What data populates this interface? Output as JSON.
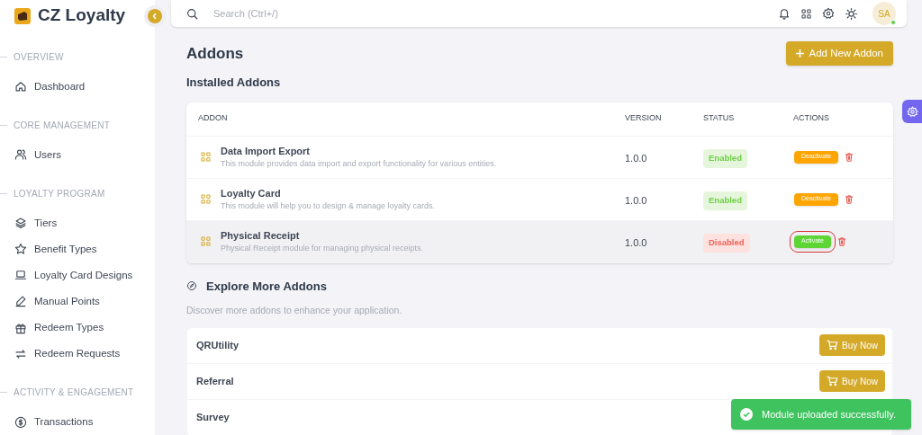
{
  "brand": "CZ Loyalty",
  "sidebar": {
    "sections": [
      {
        "title": "OVERVIEW",
        "items": [
          {
            "label": "Dashboard"
          }
        ]
      },
      {
        "title": "CORE MANAGEMENT",
        "items": [
          {
            "label": "Users"
          }
        ]
      },
      {
        "title": "LOYALTY PROGRAM",
        "items": [
          {
            "label": "Tiers"
          },
          {
            "label": "Benefit Types"
          },
          {
            "label": "Loyalty Card Designs"
          },
          {
            "label": "Manual Points"
          },
          {
            "label": "Redeem Types"
          },
          {
            "label": "Redeem Requests"
          }
        ]
      },
      {
        "title": "ACTIVITY & ENGAGEMENT",
        "items": [
          {
            "label": "Transactions"
          }
        ]
      }
    ]
  },
  "search": {
    "placeholder": "Search (Ctrl+/)"
  },
  "avatar": {
    "initials": "SA",
    "online": true
  },
  "page_title": "Addons",
  "add_button": "Add New Addon",
  "installed": {
    "title": "Installed Addons",
    "columns": [
      "ADDON",
      "VERSION",
      "STATUS",
      "ACTIONS"
    ],
    "rows": [
      {
        "name": "Data Import Export",
        "description": "This module provides data import and export functionality for various entities.",
        "version": "1.0.0",
        "status": "Enabled",
        "enabled": true,
        "action": "Deactivate",
        "highlighted": false,
        "outlined": false
      },
      {
        "name": "Loyalty Card",
        "description": "This module will help you to design & manage loyalty cards.",
        "version": "1.0.0",
        "status": "Enabled",
        "enabled": true,
        "action": "Deactivate",
        "highlighted": false,
        "outlined": false
      },
      {
        "name": "Physical Receipt",
        "description": "Physical Receipt module for managing physical receipts.",
        "version": "1.0.0",
        "status": "Disabled",
        "enabled": false,
        "action": "Activate",
        "highlighted": true,
        "outlined": true
      }
    ]
  },
  "explore": {
    "title": "Explore More Addons",
    "subtitle": "Discover more addons to enhance your application.",
    "items": [
      {
        "name": "QRUtility",
        "button": "Buy Now"
      },
      {
        "name": "Referral",
        "button": "Buy Now"
      },
      {
        "name": "Survey"
      }
    ]
  },
  "toast": {
    "message": "Module uploaded successfully."
  }
}
